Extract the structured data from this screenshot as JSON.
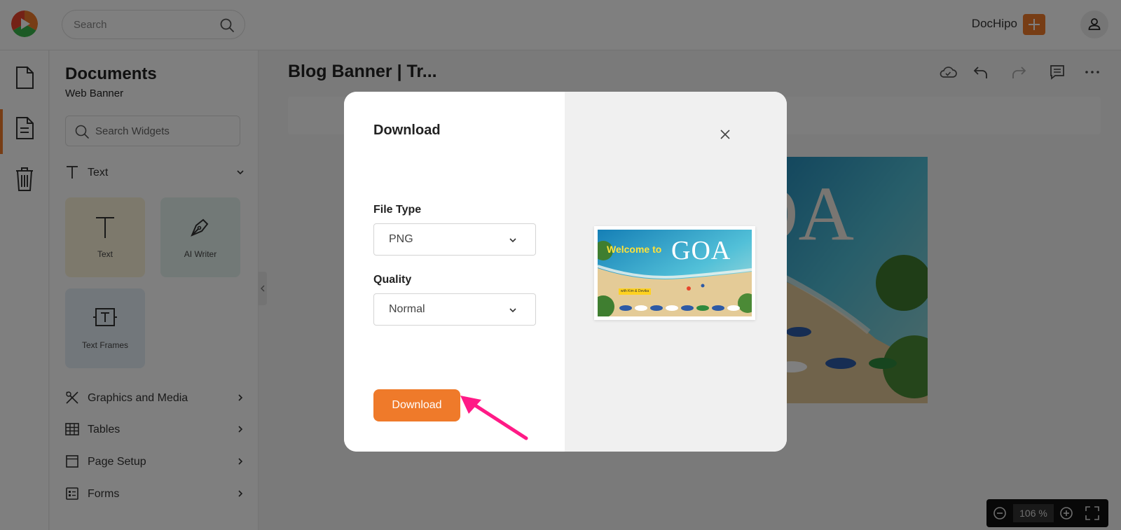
{
  "colors": {
    "accent": "#ef7a2a",
    "annotation_arrow": "#ff1a86"
  },
  "topbar": {
    "logo": "dochipo-logo",
    "search_placeholder": "Search",
    "search_icon": "search-icon",
    "brand_name": "DocHipo",
    "brand_chevron": "chevron-down-icon",
    "add_icon": "plus-icon",
    "user_icon": "user-icon"
  },
  "rail": {
    "items": [
      {
        "icon": "document-icon"
      },
      {
        "icon": "text-document-icon",
        "active": true
      },
      {
        "icon": "trash-icon"
      }
    ]
  },
  "panel": {
    "title": "Documents",
    "subtitle": "Web Banner",
    "search_placeholder": "Search Widgets",
    "text_section": "Text",
    "tiles": [
      {
        "label": "Text",
        "icon": "text-icon"
      },
      {
        "label": "AI Writer",
        "icon": "pen-nib-icon"
      },
      {
        "label": "Text Frames",
        "icon": "text-frame-icon"
      }
    ],
    "sections": [
      {
        "label": "Graphics and Media",
        "icon": "graphics-icon"
      },
      {
        "label": "Tables",
        "icon": "table-icon"
      },
      {
        "label": "Page Setup",
        "icon": "page-setup-icon"
      },
      {
        "label": "Forms",
        "icon": "form-icon"
      }
    ]
  },
  "editor": {
    "doc_title": "Blog Banner | Tr...",
    "header_icons": [
      "cloud-sync-icon",
      "undo-icon",
      "redo-icon",
      "comment-icon",
      "more-icon"
    ],
    "zoom": {
      "value": "106 %",
      "zoom_out_icon": "zoom-out-icon",
      "zoom_in_icon": "zoom-in-icon",
      "fullscreen_icon": "fullscreen-icon"
    }
  },
  "modal": {
    "title": "Download",
    "close_icon": "close-icon",
    "file_type_label": "File Type",
    "file_type_value": "PNG",
    "quality_label": "Quality",
    "quality_value": "Normal",
    "download_button": "Download",
    "preview": {
      "welcome_text": "Welcome to",
      "goa_text": "GOA",
      "tag_text": "with Kim & Devika"
    }
  }
}
